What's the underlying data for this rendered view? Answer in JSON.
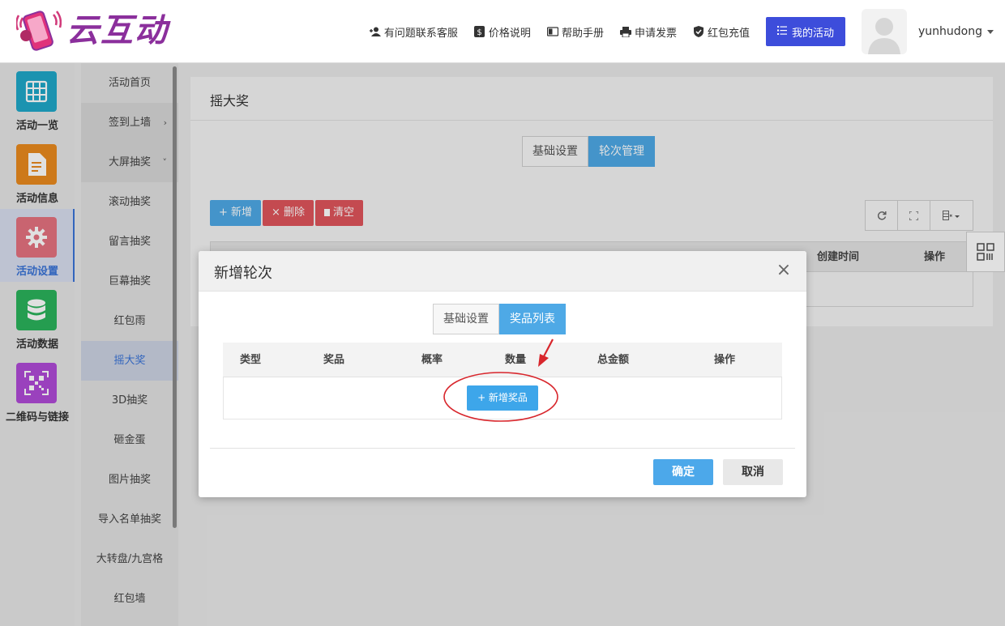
{
  "brand": {
    "name": "云互动"
  },
  "top_nav": {
    "items": [
      {
        "label": "有问题联系客服",
        "icon": "add-user-icon"
      },
      {
        "label": "价格说明",
        "icon": "dollar-icon"
      },
      {
        "label": "帮助手册",
        "icon": "book-icon"
      },
      {
        "label": "申请发票",
        "icon": "printer-icon"
      },
      {
        "label": "红包充值",
        "icon": "shield-check-icon"
      }
    ],
    "my_activity": "我的活动",
    "username": "yunhudong"
  },
  "left_nav": {
    "items": [
      {
        "label": "活动一览",
        "icon": "grid-icon",
        "color": "#1fa8c9"
      },
      {
        "label": "活动信息",
        "icon": "document-icon",
        "color": "#ea8a1e"
      },
      {
        "label": "活动设置",
        "icon": "gear-icon",
        "color": "#e57280",
        "active": true
      },
      {
        "label": "活动数据",
        "icon": "database-icon",
        "color": "#2bb35c"
      },
      {
        "label": "二维码与链接",
        "icon": "qrcode-icon",
        "color": "#b04bd8"
      }
    ]
  },
  "sub_nav": {
    "items": [
      {
        "label": "活动首页"
      },
      {
        "label": "签到上墙",
        "chevron": "›"
      },
      {
        "label": "大屏抽奖",
        "chevron": "˅"
      },
      {
        "label": "滚动抽奖"
      },
      {
        "label": "留言抽奖"
      },
      {
        "label": "巨幕抽奖"
      },
      {
        "label": "红包雨"
      },
      {
        "label": "摇大奖",
        "active": true
      },
      {
        "label": "3D抽奖"
      },
      {
        "label": "砸金蛋"
      },
      {
        "label": "图片抽奖"
      },
      {
        "label": "导入名单抽奖"
      },
      {
        "label": "大转盘/九宫格"
      },
      {
        "label": "红包墙"
      }
    ]
  },
  "main": {
    "title": "摇大奖",
    "tabs": [
      "基础设置",
      "轮次管理"
    ],
    "active_tab": "轮次管理",
    "toolbar": {
      "add": "+ 新增",
      "delete": "× 删除",
      "clear": "清空"
    },
    "table_headers": [
      "创建时间",
      "操作"
    ]
  },
  "modal": {
    "title": "新增轮次",
    "tabs": [
      "基础设置",
      "奖品列表"
    ],
    "active_tab": "奖品列表",
    "table_headers": [
      "类型",
      "奖品",
      "概率",
      "数量",
      "总金额",
      "操作"
    ],
    "add_prize": "+ 新增奖品",
    "confirm": "确定",
    "cancel": "取消"
  },
  "colors": {
    "primary": "#3da6ea",
    "danger": "#e0555c",
    "brand": "#8b2f9c",
    "annotation": "#d8262c"
  }
}
